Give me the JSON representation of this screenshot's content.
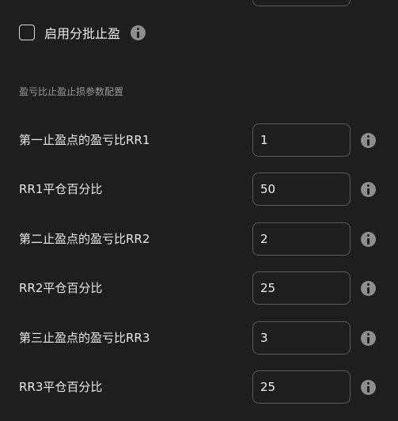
{
  "partial_tp": {
    "checkbox_label": "启用分批止盈",
    "checked": false
  },
  "section": {
    "title": "盈亏比止盈止损参数配置"
  },
  "fields": [
    {
      "label": "第一止盈点的盈亏比RR1",
      "value": "1"
    },
    {
      "label": "RR1平仓百分比",
      "value": "50"
    },
    {
      "label": "第二止盈点的盈亏比RR2",
      "value": "2"
    },
    {
      "label": "RR2平仓百分比",
      "value": "25"
    },
    {
      "label": "第三止盈点的盈亏比RR3",
      "value": "3"
    },
    {
      "label": "RR3平仓百分比",
      "value": "25"
    }
  ],
  "icons": {
    "info": "info-icon",
    "checkbox": "checkbox-icon"
  },
  "colors": {
    "background": "#1e1e1e",
    "border": "#5a5a5a",
    "info_icon": "#8e8e8e"
  }
}
